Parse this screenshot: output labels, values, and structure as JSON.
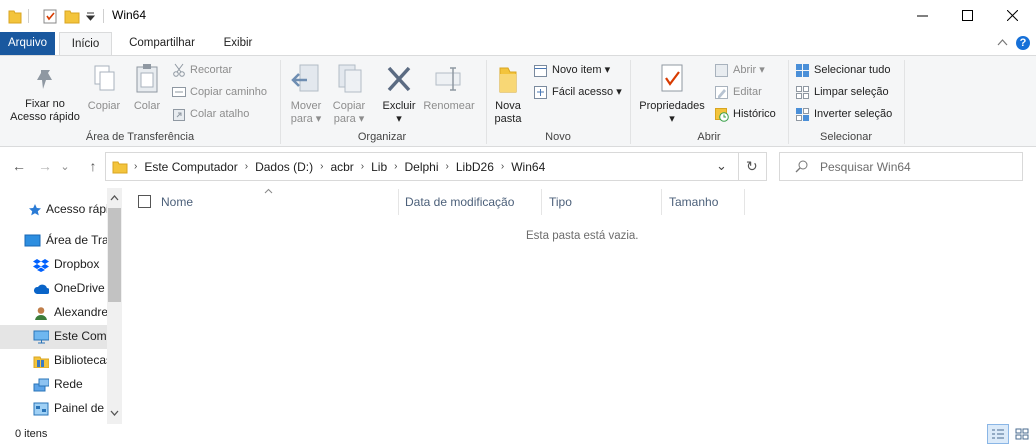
{
  "window": {
    "title": "Win64",
    "minimize_glyph": "—",
    "maximize_glyph": "☐",
    "close_glyph": "✕"
  },
  "ribbon_tabs": {
    "file": "Arquivo",
    "home": "Início",
    "share": "Compartilhar",
    "view": "Exibir"
  },
  "ribbon": {
    "clipboard": {
      "pin": "Fixar no\nAcesso rápido",
      "copy": "Copiar",
      "paste": "Colar",
      "cut": "Recortar",
      "copy_path": "Copiar caminho",
      "paste_shortcut": "Colar atalho",
      "label": "Área de Transferência"
    },
    "organize": {
      "move_to": "Mover\npara ▾",
      "copy_to": "Copiar\npara ▾",
      "delete": "Excluir\n▾",
      "rename": "Renomear",
      "label": "Organizar"
    },
    "new": {
      "new_folder": "Nova\npasta",
      "new_item": "Novo item ▾",
      "easy_access": "Fácil acesso ▾",
      "label": "Novo"
    },
    "open": {
      "properties": "Propriedades\n▾",
      "open": "Abrir ▾",
      "edit": "Editar",
      "history": "Histórico",
      "label": "Abrir"
    },
    "select": {
      "select_all": "Selecionar tudo",
      "select_none": "Limpar seleção",
      "invert": "Inverter seleção",
      "label": "Selecionar"
    }
  },
  "address": {
    "back": "←",
    "forward": "→",
    "recent": "⌄",
    "up": "↑",
    "breadcrumbs": [
      "Este Computador",
      "Dados (D:)",
      "acbr",
      "Lib",
      "Delphi",
      "LibD26",
      "Win64"
    ],
    "dropdown": "⌄",
    "refresh": "↻"
  },
  "search": {
    "placeholder": "Pesquisar Win64"
  },
  "nav_pane": {
    "items": [
      {
        "label": "Acesso rápido",
        "icon": "star-icon"
      },
      {
        "label": "Área de Trabalho",
        "icon": "desktop-icon"
      },
      {
        "label": "Dropbox",
        "icon": "dropbox-icon"
      },
      {
        "label": "OneDrive",
        "icon": "cloud-icon"
      },
      {
        "label": "Alexandre",
        "icon": "user-icon"
      },
      {
        "label": "Este Computador",
        "icon": "computer-icon"
      },
      {
        "label": "Bibliotecas",
        "icon": "library-icon"
      },
      {
        "label": "Rede",
        "icon": "network-icon"
      },
      {
        "label": "Painel de Controle",
        "icon": "control-panel-icon"
      }
    ]
  },
  "columns": {
    "name": "Nome",
    "modified": "Data de modificação",
    "type": "Tipo",
    "size": "Tamanho"
  },
  "content": {
    "empty_message": "Esta pasta está vazia."
  },
  "status": {
    "item_count": "0 itens"
  }
}
